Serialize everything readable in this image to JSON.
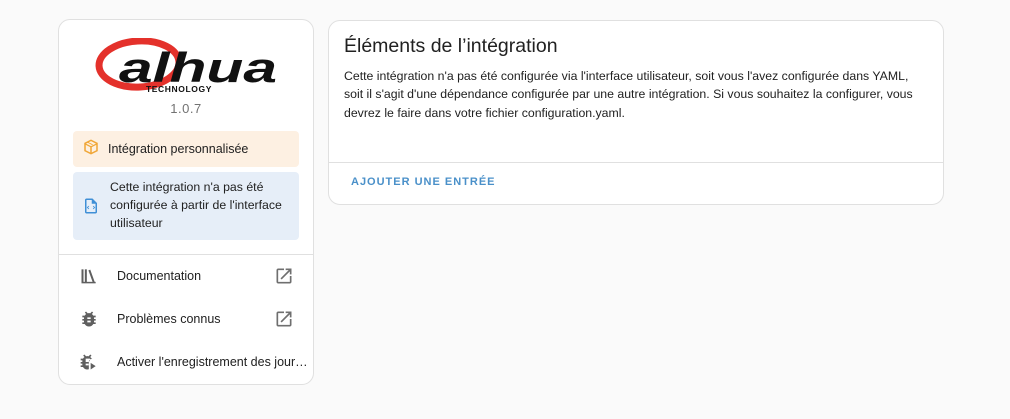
{
  "integration": {
    "logo_text": "alhua",
    "logo_subtext": "TECHNOLOGY",
    "version": "1.0.7"
  },
  "banners": {
    "custom": "Intégration personnalisée",
    "yaml": "Cette intégration n'a pas été configurée à partir de l'interface utilisateur"
  },
  "links": [
    {
      "label": "Documentation",
      "icon": "book-shelf-icon",
      "trailing_icon": "open-in-new-icon"
    },
    {
      "label": "Problèmes connus",
      "icon": "bug-icon",
      "trailing_icon": "open-in-new-icon"
    },
    {
      "label": "Activer l'enregistrement des journaux de débogage",
      "icon": "bug-play-icon"
    }
  ],
  "entries_card": {
    "title": "Éléments de l’intégration",
    "body": "Cette intégration n'a pas été configurée via l'interface utilisateur, soit vous l'avez configurée dans YAML, soit il s'agit d'une dépendance configurée par une autre intégration. Si vous souhaitez la configurer, vous devrez le faire dans votre fichier configuration.yaml.",
    "add_entry": "AJOUTER UNE ENTRÉE"
  },
  "colors": {
    "logo_red": "#e4312b",
    "custom_banner_bg": "#fdf0e2",
    "custom_icon": "#f0a636",
    "yaml_banner_bg": "#e6eef8",
    "yaml_icon": "#3f8fd6",
    "accent": "#4a90c9"
  }
}
